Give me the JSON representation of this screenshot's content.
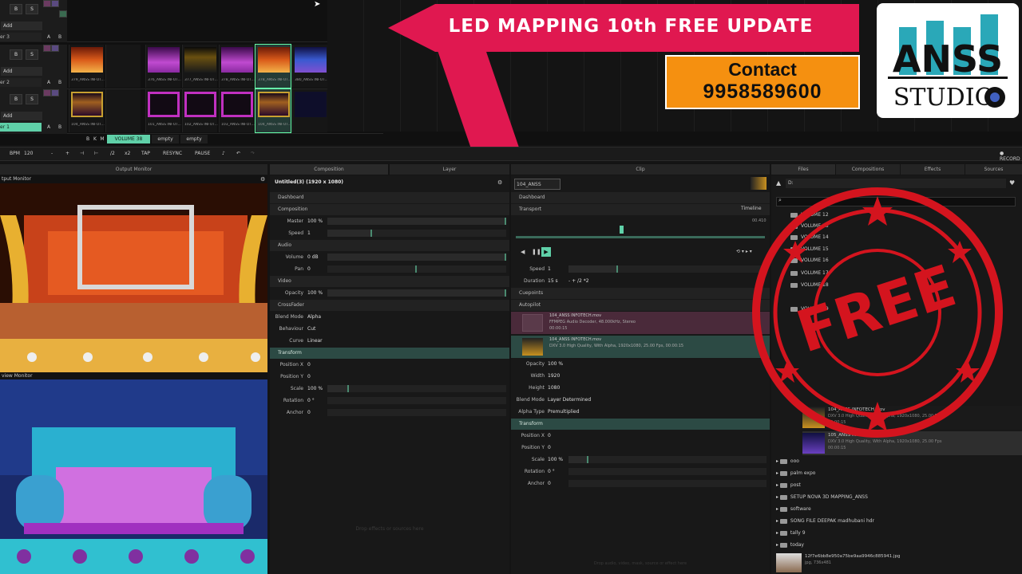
{
  "deck": {
    "layers": [
      {
        "name": "er 3",
        "add": "Add",
        "b": "B",
        "s": "S",
        "a": "A",
        "bb": "B"
      },
      {
        "name": "er 2",
        "add": "Add",
        "b": "B",
        "s": "S",
        "a": "A",
        "bb": "B"
      },
      {
        "name": "er 1",
        "add": "Add",
        "b": "B",
        "s": "S",
        "a": "A",
        "bb": "B"
      }
    ],
    "row2_clips": [
      "379_ANSS INFOT...",
      "376_ANSS INFOT...",
      "377_ANSS INFOT...",
      "378_ANSS INFOT...",
      "378_ANSS INFOT...",
      "380_ANSS INFOT..."
    ],
    "row3_clips": [
      "104_ANSS INFOT...",
      "101_ANSS INFOT...",
      "102_ANSS INFOT...",
      "103_ANSS INFOT...",
      "104_ANSS INFOT..."
    ],
    "deck_tabs": [
      "VOLUME 38",
      "empty",
      "empty"
    ],
    "deck_nav": [
      "B",
      "K",
      "M"
    ]
  },
  "banner": {
    "title": "LED MAPPING 10th FREE UPDATE"
  },
  "contact": {
    "line1": "Contact",
    "line2": "9958589600"
  },
  "logo": {
    "line1": "ANSS",
    "line2": "STUDIO"
  },
  "toolbar": {
    "bpm_label": "BPM",
    "bpm": "120",
    "minus": "-",
    "plus": "+",
    "div2": "/2",
    "x2": "x2",
    "tap": "TAP",
    "resync": "RESYNC",
    "pause": "PAUSE",
    "record": "RECORD"
  },
  "output": {
    "header": "Output Monitor",
    "label1": "tput Monitor",
    "label2": "view Monitor"
  },
  "layer_panel": {
    "tab_composition": "Composition",
    "tab_layer": "Layer",
    "title": "Untitled(3) (1920 x 1080)",
    "dashboard": "Dashboard",
    "composition": "Composition",
    "master_label": "Master",
    "master_val": "100 %",
    "speed_label": "Speed",
    "speed_val": "1",
    "audio": "Audio",
    "volume_label": "Volume",
    "volume_val": "0 dB",
    "pan_label": "Pan",
    "pan_val": "0",
    "video": "Video",
    "opacity_label": "Opacity",
    "opacity_val": "100 %",
    "crossfader": "CrossFader",
    "blend_label": "Blend Mode",
    "blend_val": "Alpha",
    "behaviour_label": "Behaviour",
    "behaviour_val": "Cut",
    "curve_label": "Curve",
    "curve_val": "Linear",
    "transform": "Transform",
    "posx_label": "Position X",
    "posx_val": "0",
    "posy_label": "Position Y",
    "posy_val": "0",
    "scale_label": "Scale",
    "scale_val": "100 %",
    "rotation_label": "Rotation",
    "rotation_val": "0 °",
    "anchor_label": "Anchor",
    "anchor_val": "0",
    "placeholder": "Drop effects or sources here"
  },
  "clip_panel": {
    "tab": "Clip",
    "name": "104_ANSS INFOTECH",
    "dashboard": "Dashboard",
    "transport": "Transport",
    "timeline": "Timeline",
    "time": "00.410",
    "speed_label": "Speed",
    "speed_val": "1",
    "duration_label": "Duration",
    "duration_val": "15 s",
    "cuepoints": "Cuepoints",
    "autopilot": "Autopilot",
    "audio_file": "104_ANSS INFOTECH.mov",
    "audio_info": "FFMPEG Audio Decoder, 48.000kHz, Stereo",
    "audio_time": "00:00:15",
    "video_file": "104_ANSS INFOTECH.mov",
    "video_info": "DXV 3.0 High Quality, With Alpha, 1920x1080, 25.00 Fps, 00:00:15",
    "opacity_label": "Opacity",
    "opacity_val": "100 %",
    "width_label": "Width",
    "width_val": "1920",
    "height_label": "Height",
    "height_val": "1080",
    "blend_label": "Blend Mode",
    "blend_val": "Layer Determined",
    "alpha_label": "Alpha Type",
    "alpha_val": "Premultiplied",
    "transform": "Transform",
    "posx_label": "Position X",
    "posx_val": "0",
    "posy_label": "Position Y",
    "posy_val": "0",
    "scale_label": "Scale",
    "scale_val": "100 %",
    "rotation_label": "Rotation",
    "rotation_val": "0 °",
    "anchor_label": "Anchor",
    "anchor_val": "0",
    "placeholder": "Drop audio, video, mask, source or effect here"
  },
  "files_panel": {
    "tabs": [
      "Files",
      "Compositions",
      "Effects",
      "Sources"
    ],
    "drive": "D:",
    "volumes": [
      "VOLUME 12",
      "VOLUME 13",
      "VOLUME 14",
      "VOLUME 15",
      "VOLUME 16",
      "VOLUME 17",
      "VOLUME 18",
      "VOLUME 19"
    ],
    "files": [
      {
        "name": "104_ANSS INFOTECH.mov",
        "info": "DXV 3.0 High Quality, With Alpha, 1920x1080, 25.00 Fps",
        "time": "00:00:15"
      },
      {
        "name": "105_ANSS INFOTECH.mov",
        "info": "DXV 3.0 High Quality, With Alpha, 1920x1080, 25.00 Fps",
        "time": "00:00:15"
      }
    ],
    "folders": [
      "ooo",
      "palm expo",
      "post",
      "SETUP NOVA 3D MAPPING_ANSS",
      "software",
      "SONG FILE DEEPAK madhubani hdr",
      "tally 9",
      "today"
    ],
    "jpg_name": "12f7e6bb8e950a75be9aa9946c885941.jpg",
    "jpg_info": "jpg, 736x481"
  },
  "stamp": {
    "text": "FREE"
  },
  "colors": {
    "accent": "#4a8a70",
    "banner": "#e01850",
    "contact": "#f59010",
    "stamp": "#d4141e"
  }
}
